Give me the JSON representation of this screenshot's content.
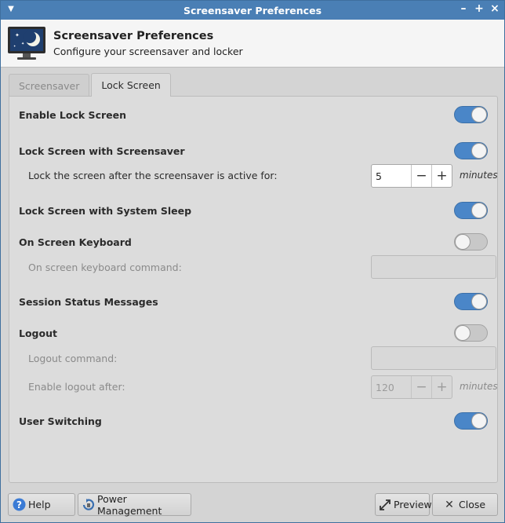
{
  "window": {
    "title": "Screensaver Preferences",
    "controls": {
      "minimize": "–",
      "maximize": "+",
      "close": "×"
    }
  },
  "header": {
    "title": "Screensaver Preferences",
    "subtitle": "Configure your screensaver and locker",
    "icon": "monitor-moon-icon"
  },
  "tabs": [
    {
      "label": "Screensaver",
      "active": false
    },
    {
      "label": "Lock Screen",
      "active": true
    }
  ],
  "settings": {
    "enable_lock_screen": {
      "label": "Enable Lock Screen",
      "on": true
    },
    "lock_with_screensaver": {
      "label": "Lock Screen with Screensaver",
      "on": true
    },
    "lock_after": {
      "label": "Lock the screen after the screensaver is active for:",
      "value": "5",
      "unit": "minutes"
    },
    "lock_with_sleep": {
      "label": "Lock Screen with System Sleep",
      "on": true
    },
    "on_screen_keyboard": {
      "label": "On Screen Keyboard",
      "on": false
    },
    "osk_command": {
      "label": "On screen keyboard command:",
      "value": ""
    },
    "session_status": {
      "label": "Session Status Messages",
      "on": true
    },
    "logout": {
      "label": "Logout",
      "on": false
    },
    "logout_command": {
      "label": "Logout command:",
      "value": ""
    },
    "logout_after": {
      "label": "Enable logout after:",
      "value": "120",
      "unit": "minutes"
    },
    "user_switching": {
      "label": "User Switching",
      "on": true
    }
  },
  "spin_symbols": {
    "minus": "−",
    "plus": "+"
  },
  "buttons": {
    "help": "Help",
    "power": "Power Management",
    "preview": "Preview",
    "close": "Close"
  },
  "colors": {
    "titlebar": "#4a7fb5",
    "switch_on": "#4a86c8",
    "switch_off": "#c8c8c8"
  }
}
